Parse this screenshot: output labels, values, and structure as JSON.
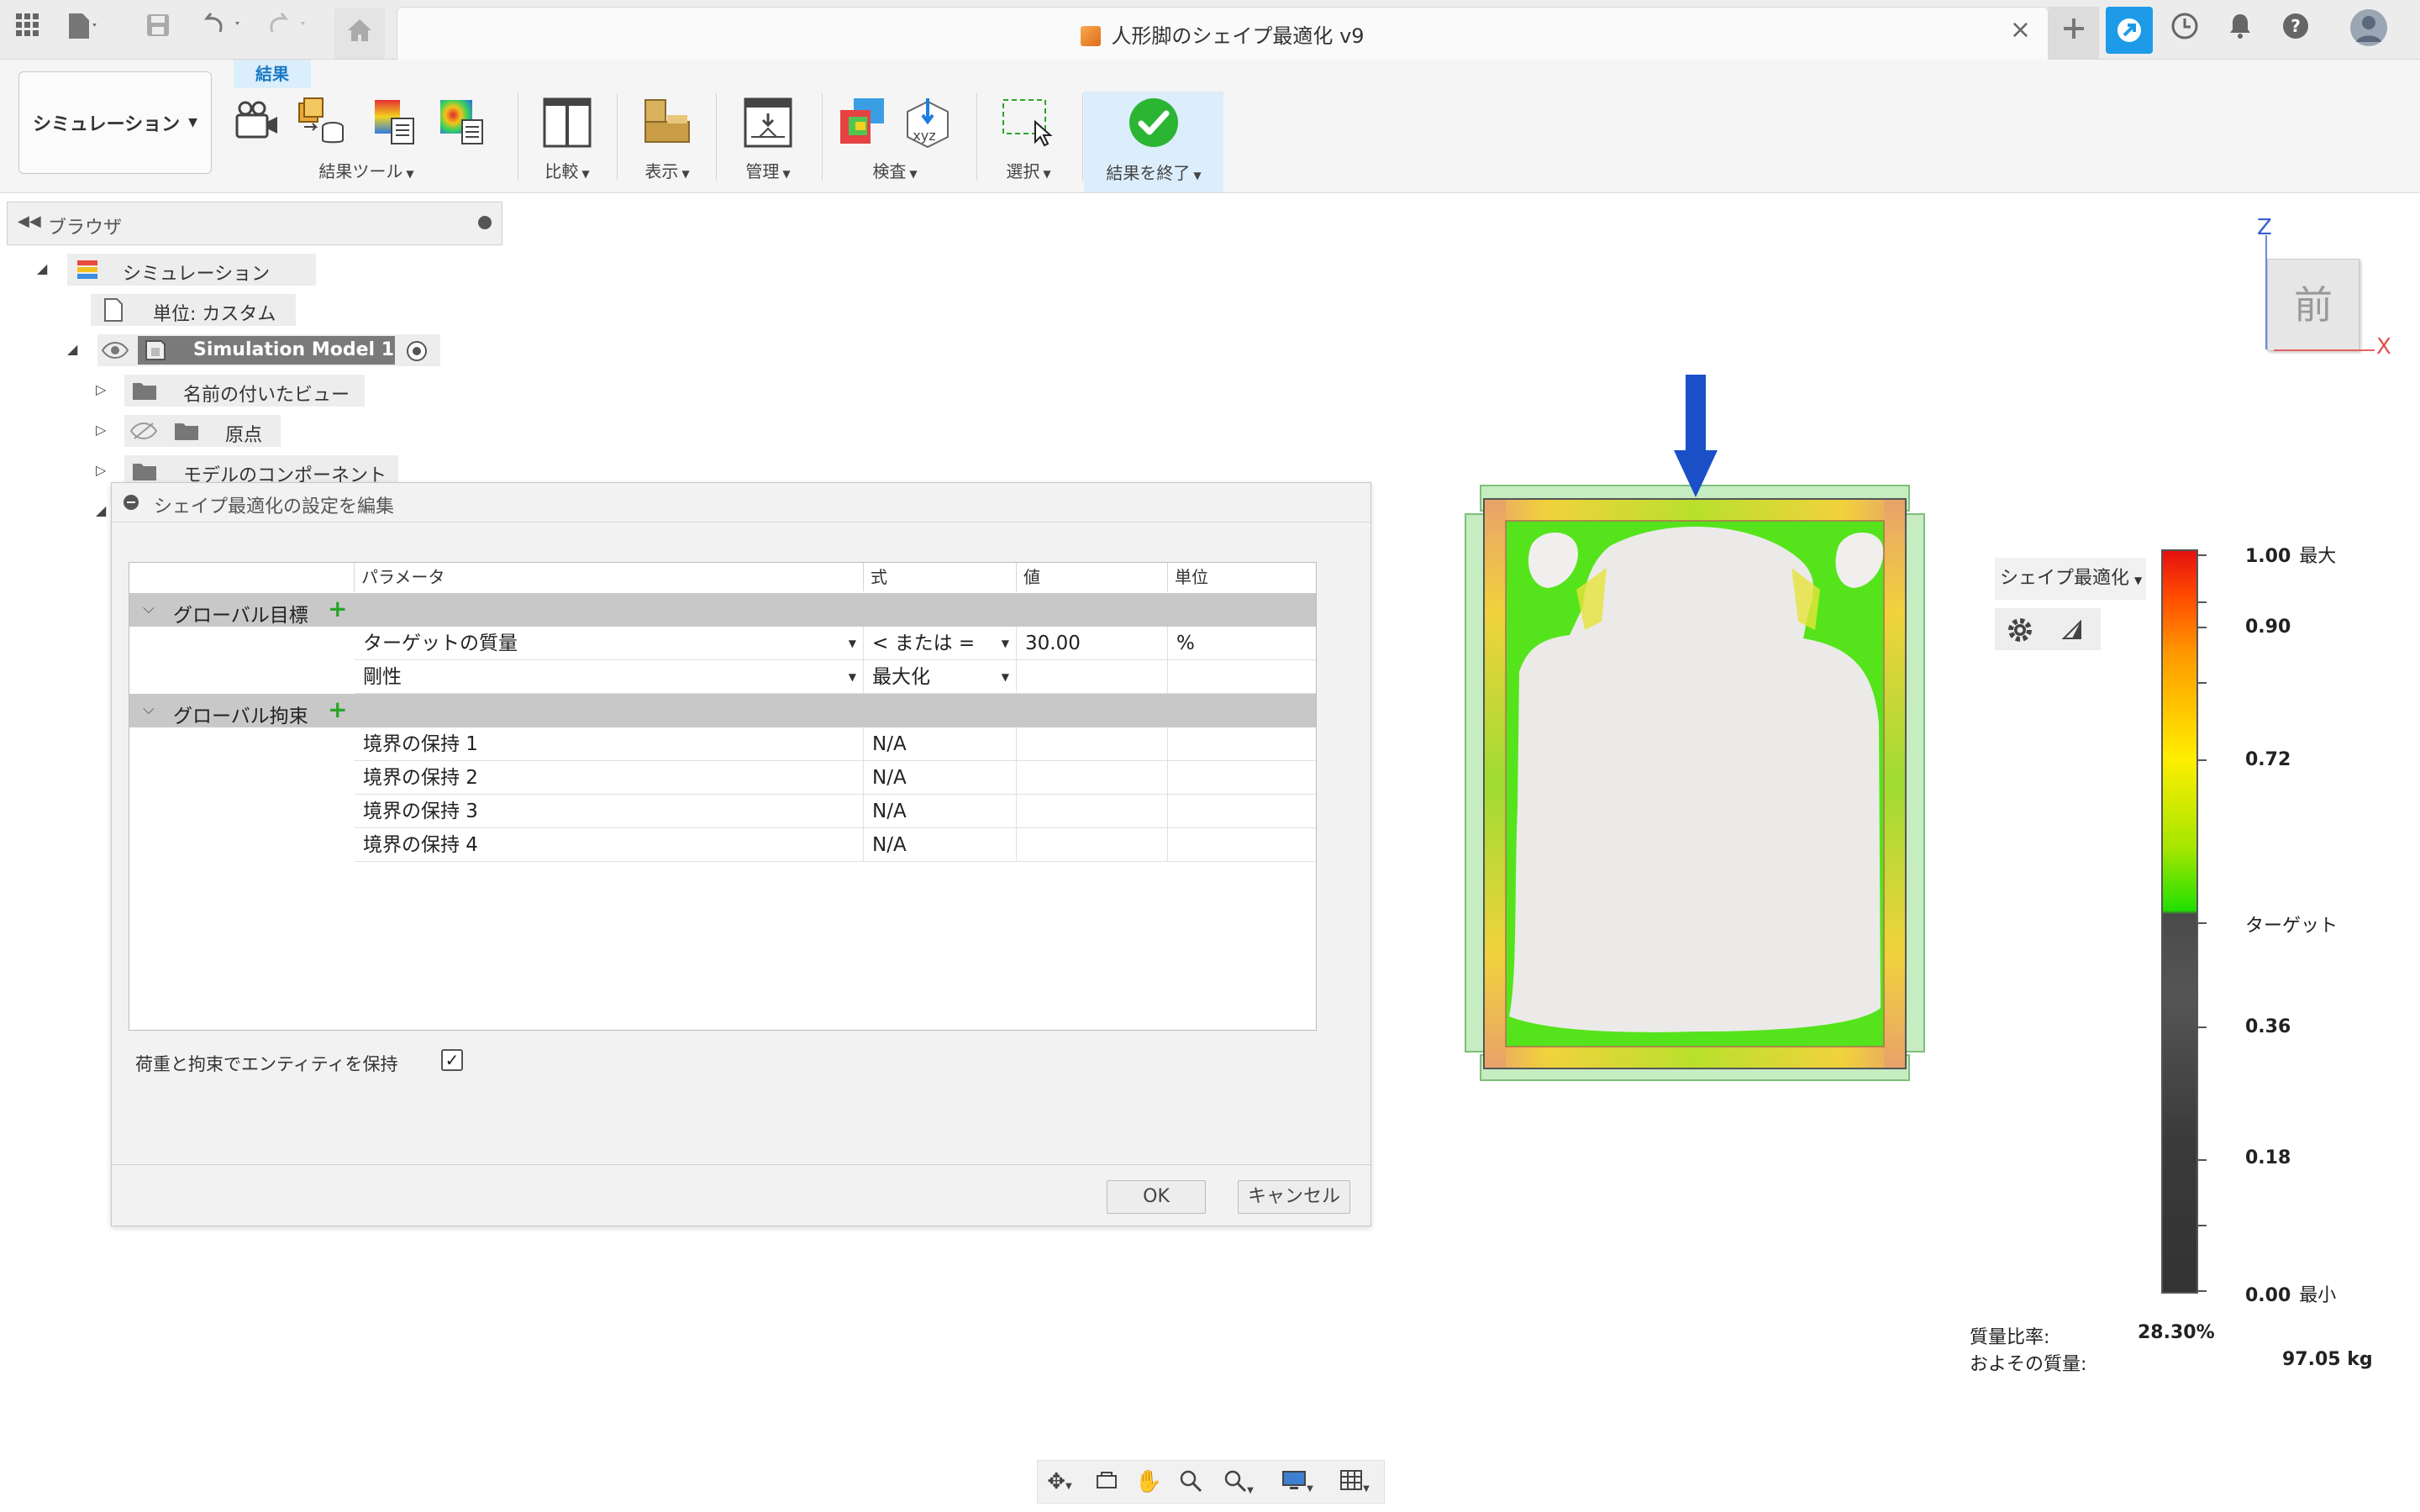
{
  "titlebar": {
    "doc_title": "人形脚のシェイプ最適化 v9",
    "close_label": "×",
    "icons": [
      "grid-menu-icon",
      "file-icon",
      "save-icon",
      "undo-icon",
      "redo-icon",
      "home-icon",
      "add-tab-icon",
      "extensions-icon",
      "job-status-icon",
      "notifications-icon",
      "help-icon",
      "profile-avatar"
    ]
  },
  "ribbon": {
    "workspace_label": "シミュレーション",
    "active_tab": "結果",
    "groups": {
      "results_tools": "結果ツール",
      "compare": "比較",
      "display": "表示",
      "manage": "管理",
      "inspect": "検査",
      "select": "選択",
      "finish": "結果を終了"
    }
  },
  "browser": {
    "title": "ブラウザ",
    "items": {
      "root": "シミュレーション",
      "units": "単位: カスタム",
      "model": "Simulation Model 1",
      "named_views": "名前の付いたビュー",
      "origin": "原点",
      "components": "モデルのコンポーネント"
    }
  },
  "dialog": {
    "title": "シェイプ最適化の設定を編集",
    "columns": [
      "パラメータ",
      "式",
      "値",
      "単位"
    ],
    "global_objectives": {
      "label": "グローバル目標",
      "rows": [
        {
          "param": "ターゲットの質量",
          "expr": "< または =",
          "value": "30.00",
          "unit": "%"
        },
        {
          "param": "剛性",
          "expr": "最大化",
          "value": "",
          "unit": ""
        }
      ]
    },
    "global_constraints": {
      "label": "グローバル拘束",
      "rows": [
        {
          "param": "境界の保持 1",
          "expr": "N/A"
        },
        {
          "param": "境界の保持 2",
          "expr": "N/A"
        },
        {
          "param": "境界の保持 3",
          "expr": "N/A"
        },
        {
          "param": "境界の保持 4",
          "expr": "N/A"
        }
      ]
    },
    "keep_entities_label": "荷重と拘束でエンティティを保持",
    "keep_entities_checked": true,
    "ok_label": "OK",
    "cancel_label": "キャンセル"
  },
  "legend": {
    "dropdown": "シェイプ最適化",
    "labels": {
      "max_val": "1.00",
      "max_suffix": "最大",
      "v090": "0.90",
      "v072": "0.72",
      "target": "ターゲット",
      "v036": "0.36",
      "v018": "0.18",
      "min_val": "0.00",
      "min_suffix": "最小"
    },
    "colors": {
      "max": "#e51010",
      "target": "#22e000",
      "below": "#444444"
    }
  },
  "viewcube": {
    "face": "前",
    "z": "Z",
    "x": "X"
  },
  "stats": {
    "mass_ratio_label": "質量比率:",
    "mass_ratio_value": "28.30%",
    "approx_mass_label": "およその質量:",
    "approx_mass_value": "97.05 kg"
  }
}
